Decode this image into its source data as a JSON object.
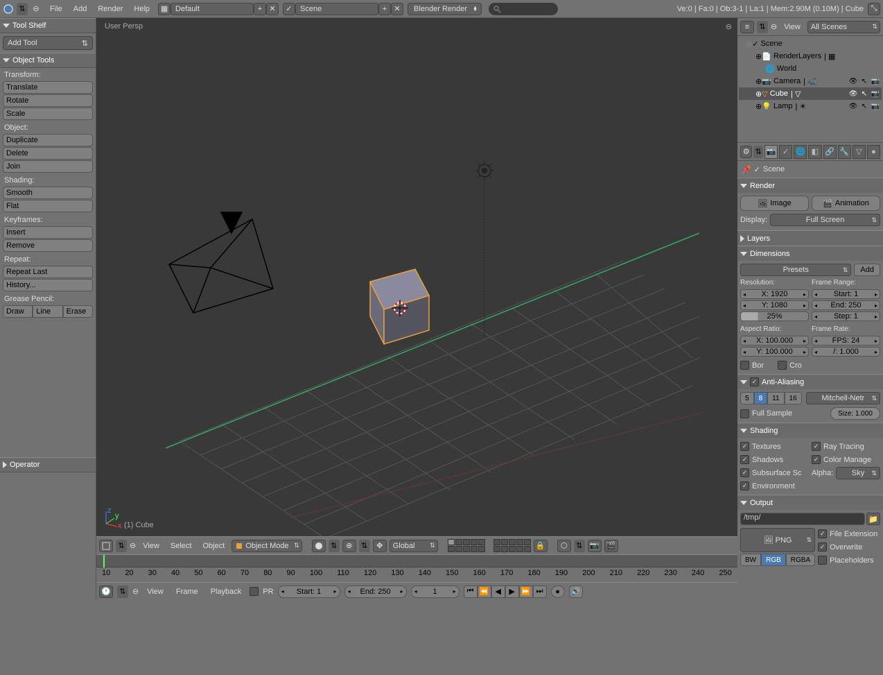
{
  "header": {
    "menus": [
      "File",
      "Add",
      "Render",
      "Help"
    ],
    "layout_field": "Default",
    "scene_field": "Scene",
    "engine": "Blender Render",
    "stats": "Ve:0 | Fa:0 | Ob:3-1 | La:1 | Mem:2.90M (0.10M) | Cube"
  },
  "tool_shelf": {
    "title": "Tool Shelf",
    "add_tool": "Add Tool",
    "object_tools_title": "Object Tools",
    "transform_label": "Transform:",
    "transform": [
      "Translate",
      "Rotate",
      "Scale"
    ],
    "object_label": "Object:",
    "object": [
      "Duplicate",
      "Delete",
      "Join"
    ],
    "shading_label": "Shading:",
    "shading": [
      "Smooth",
      "Flat"
    ],
    "keyframes_label": "Keyframes:",
    "keyframes": [
      "Insert",
      "Remove"
    ],
    "repeat_label": "Repeat:",
    "repeat": [
      "Repeat Last",
      "History..."
    ],
    "grease_label": "Grease Pencil:",
    "grease": [
      "Draw",
      "Line",
      "Erase"
    ],
    "operator_title": "Operator"
  },
  "viewport": {
    "info": "User Persp",
    "object_label": "(1) Cube"
  },
  "view_header": {
    "menus": [
      "View",
      "Select",
      "Object"
    ],
    "mode": "Object Mode",
    "orientation": "Global"
  },
  "timeline": {
    "labels": [
      "10",
      "20",
      "30",
      "40",
      "50",
      "60",
      "70",
      "80",
      "90",
      "100",
      "110",
      "120",
      "130",
      "140",
      "150",
      "160",
      "170",
      "180",
      "190",
      "200",
      "210",
      "220",
      "230",
      "240",
      "250"
    ]
  },
  "timeline_header": {
    "menus": [
      "View",
      "Frame",
      "Playback"
    ],
    "pr": "PR",
    "start": "Start: 1",
    "end": "End: 250",
    "current": "1"
  },
  "outliner": {
    "header_menu": "View",
    "header_dd": "All Scenes",
    "scene": "Scene",
    "render_layers": "RenderLayers",
    "world": "World",
    "camera": "Camera",
    "cube": "Cube",
    "lamp": "Lamp"
  },
  "properties": {
    "breadcrumb": "Scene",
    "render": {
      "title": "Render",
      "image": "Image",
      "animation": "Animation",
      "display_label": "Display:",
      "display": "Full Screen"
    },
    "layers_title": "Layers",
    "dimensions": {
      "title": "Dimensions",
      "presets": "Presets",
      "add": "Add",
      "res_label": "Resolution:",
      "x": "X: 1920",
      "y": "Y: 1080",
      "pct": "25%",
      "fr_label": "Frame Range:",
      "start": "Start: 1",
      "end": "End: 250",
      "step": "Step: 1",
      "ar_label": "Aspect Ratio:",
      "ax": "X: 100.000",
      "ay": "Y: 100.000",
      "frate_label": "Frame Rate:",
      "fps": "FPS: 24",
      "fstep": "/: 1.000",
      "border": "Bor",
      "crop": "Cro"
    },
    "aa": {
      "title": "Anti-Aliasing",
      "samples": [
        "5",
        "8",
        "11",
        "16"
      ],
      "filter": "Mitchell-Netr",
      "full_sample": "Full Sample",
      "size": "Size: 1.000"
    },
    "shading": {
      "title": "Shading",
      "textures": "Textures",
      "shadows": "Shadows",
      "subsurface": "Subsurface Sc",
      "environment": "Environment",
      "ray": "Ray Tracing",
      "cm": "Color Manage",
      "alpha_label": "Alpha:",
      "alpha": "Sky"
    },
    "output": {
      "title": "Output",
      "path": "/tmp/",
      "format": "PNG",
      "bw": "BW",
      "rgb": "RGB",
      "rgba": "RGBA",
      "file_ext": "File Extension",
      "overwrite": "Overwrite",
      "placeholders": "Placeholders"
    }
  }
}
